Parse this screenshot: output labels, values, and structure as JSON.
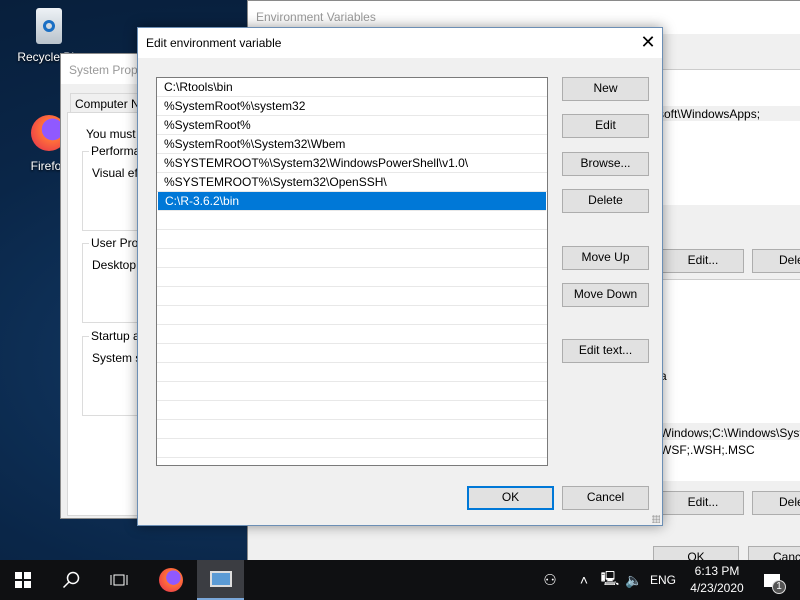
{
  "desktop": {
    "icons": [
      {
        "label": "Recycle Bin",
        "icon": "recycle-bin-icon"
      },
      {
        "label": "Firefox",
        "icon": "firefox-icon"
      }
    ]
  },
  "env_window": {
    "title": "Environment Variables",
    "user_var_text": "soft\\WindowsApps;",
    "user_edit": "Edit...",
    "user_delete": "Delete",
    "sys_text_1": "a",
    "sys_text_2": "Windows;C:\\Windows\\System",
    "sys_text_3": "WSF;.WSH;.MSC",
    "sys_edit": "Edit...",
    "sys_delete": "Delete",
    "ok": "OK",
    "cancel": "Cancel"
  },
  "sys_props": {
    "title": "System Properties",
    "tab": "Computer Name",
    "admin_note": "You must be",
    "perf_label": "Performance",
    "perf_text": "Visual effects",
    "profiles_label": "User Profiles",
    "profiles_text": "Desktop settings",
    "startup_label": "Startup and Recovery",
    "startup_text": "System startup"
  },
  "dialog": {
    "title": "Edit environment variable",
    "entries": [
      "C:\\Rtools\\bin",
      "%SystemRoot%\\system32",
      "%SystemRoot%",
      "%SystemRoot%\\System32\\Wbem",
      "%SYSTEMROOT%\\System32\\WindowsPowerShell\\v1.0\\",
      "%SYSTEMROOT%\\System32\\OpenSSH\\",
      "C:\\R-3.6.2\\bin"
    ],
    "selected_index": 6,
    "buttons": {
      "new": "New",
      "edit": "Edit",
      "browse": "Browse...",
      "delete": "Delete",
      "move_up": "Move Up",
      "move_down": "Move Down",
      "edit_text": "Edit text...",
      "ok": "OK",
      "cancel": "Cancel"
    }
  },
  "taskbar": {
    "time": "6:13 PM",
    "date": "4/23/2020",
    "language": "ENG",
    "notification_count": "1"
  },
  "colors": {
    "selection": "#0078d7",
    "taskbar": "#0f1012"
  }
}
